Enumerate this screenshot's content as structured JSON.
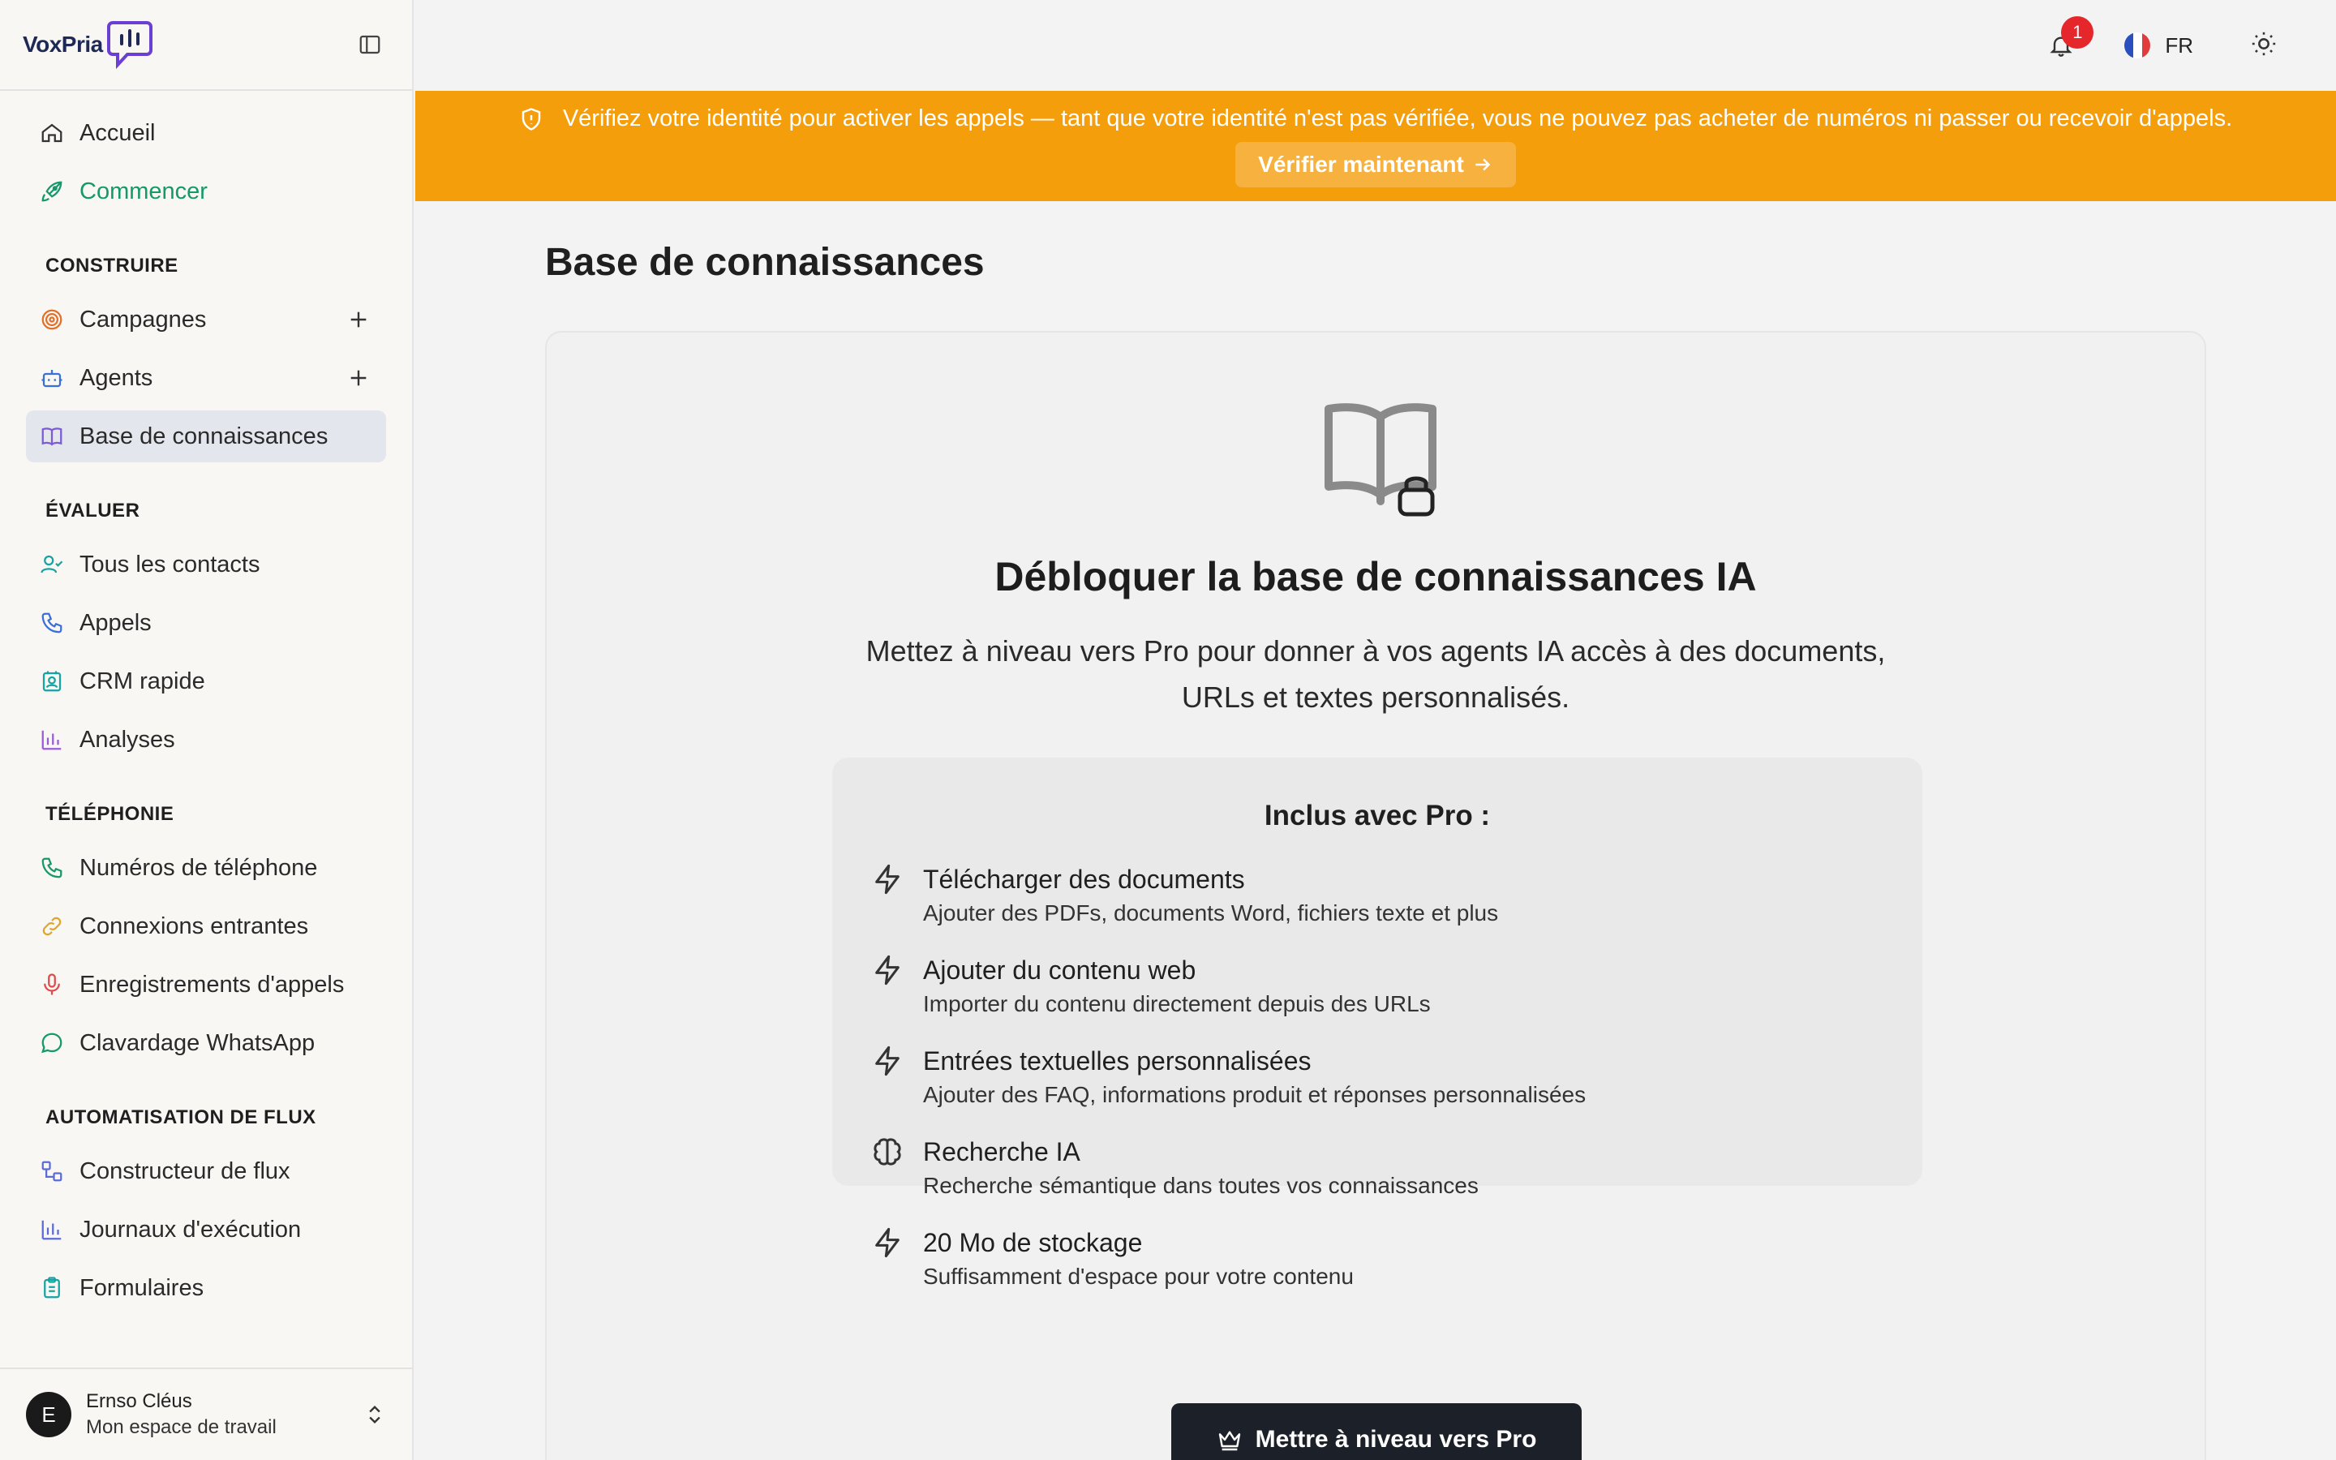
{
  "app": {
    "logo_text": "VoxPria"
  },
  "sidebar": {
    "top_items": [
      {
        "label": "Accueil",
        "icon": "home-icon"
      },
      {
        "label": "Commencer",
        "icon": "rocket-icon"
      }
    ],
    "sections": [
      {
        "title": "CONSTRUIRE",
        "items": [
          {
            "label": "Campagnes",
            "icon": "target-icon",
            "has_add": true
          },
          {
            "label": "Agents",
            "icon": "bot-icon",
            "has_add": true
          },
          {
            "label": "Base de connaissances",
            "icon": "book-icon",
            "active": true
          }
        ]
      },
      {
        "title": "ÉVALUER",
        "items": [
          {
            "label": "Tous les contacts",
            "icon": "user-check-icon"
          },
          {
            "label": "Appels",
            "icon": "phone-icon"
          },
          {
            "label": "CRM rapide",
            "icon": "contact-card-icon"
          },
          {
            "label": "Analyses",
            "icon": "bar-chart-icon"
          }
        ]
      },
      {
        "title": "TÉLÉPHONIE",
        "items": [
          {
            "label": "Numéros de téléphone",
            "icon": "phone-icon"
          },
          {
            "label": "Connexions entrantes",
            "icon": "link-icon"
          },
          {
            "label": "Enregistrements d'appels",
            "icon": "mic-icon"
          },
          {
            "label": "Clavardage WhatsApp",
            "icon": "chat-bubble-icon"
          }
        ]
      },
      {
        "title": "AUTOMATISATION DE FLUX",
        "items": [
          {
            "label": "Constructeur de flux",
            "icon": "workflow-icon"
          },
          {
            "label": "Journaux d'exécution",
            "icon": "bar-chart-icon"
          },
          {
            "label": "Formulaires",
            "icon": "clipboard-icon"
          }
        ]
      }
    ],
    "user": {
      "initial": "E",
      "name": "Ernso Cléus",
      "workspace": "Mon espace de travail"
    }
  },
  "topbar": {
    "notification_count": "1",
    "language": "FR"
  },
  "banner": {
    "message": "Vérifiez votre identité pour activer les appels — tant que votre identité n'est pas vérifiée, vous ne pouvez pas acheter de numéros ni passer ou recevoir d'appels.",
    "button_label": "Vérifier maintenant"
  },
  "main": {
    "page_title": "Base de connaissances",
    "hero_title": "Débloquer la base de connaissances IA",
    "hero_subtitle_line1": "Mettez à niveau vers Pro pour donner à vos agents IA accès à des documents,",
    "hero_subtitle_line2": "URLs et textes personnalisés.",
    "included_title": "Inclus avec Pro :",
    "features": [
      {
        "icon": "bolt-icon",
        "title": "Télécharger des documents",
        "desc": "Ajouter des PDFs, documents Word, fichiers texte et plus"
      },
      {
        "icon": "bolt-icon",
        "title": "Ajouter du contenu web",
        "desc": "Importer du contenu directement depuis des URLs"
      },
      {
        "icon": "bolt-icon",
        "title": "Entrées textuelles personnalisées",
        "desc": "Ajouter des FAQ, informations produit et réponses personnalisées"
      },
      {
        "icon": "brain-icon",
        "title": "Recherche IA",
        "desc": "Recherche sémantique dans toutes vos connaissances"
      },
      {
        "icon": "bolt-icon",
        "title": "20 Mo de stockage",
        "desc": "Suffisamment d'espace pour votre contenu"
      }
    ],
    "upgrade_label": "Mettre à niveau vers Pro"
  },
  "colors": {
    "banner": "#f59e0b",
    "accent_green": "#15986a",
    "badge_red": "#e5262a",
    "primary_dark": "#1c2029",
    "active_bg": "#e3e6ec"
  }
}
